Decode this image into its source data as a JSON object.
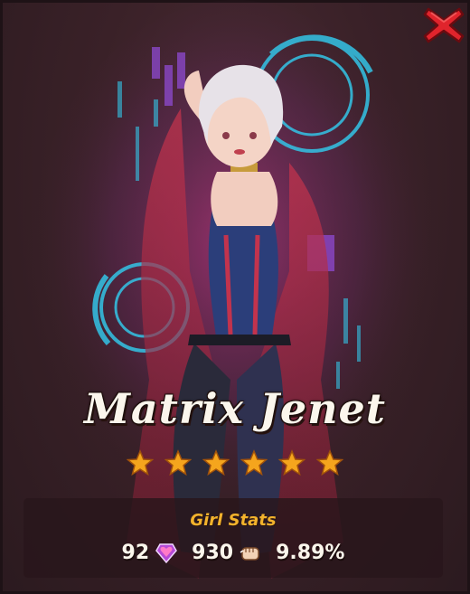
{
  "window": {
    "close_icon": "close-x-icon",
    "accent_close": "#e0242c"
  },
  "girl": {
    "name": "Matrix Jenet",
    "stars": 6,
    "star_color": "#f5a51d"
  },
  "stats": {
    "title": "Girl Stats",
    "items": [
      {
        "value": "92",
        "icon": "harmony-gem-icon"
      },
      {
        "value": "930",
        "icon": "power-fist-icon"
      },
      {
        "value": "9.89%",
        "icon": ""
      }
    ]
  }
}
